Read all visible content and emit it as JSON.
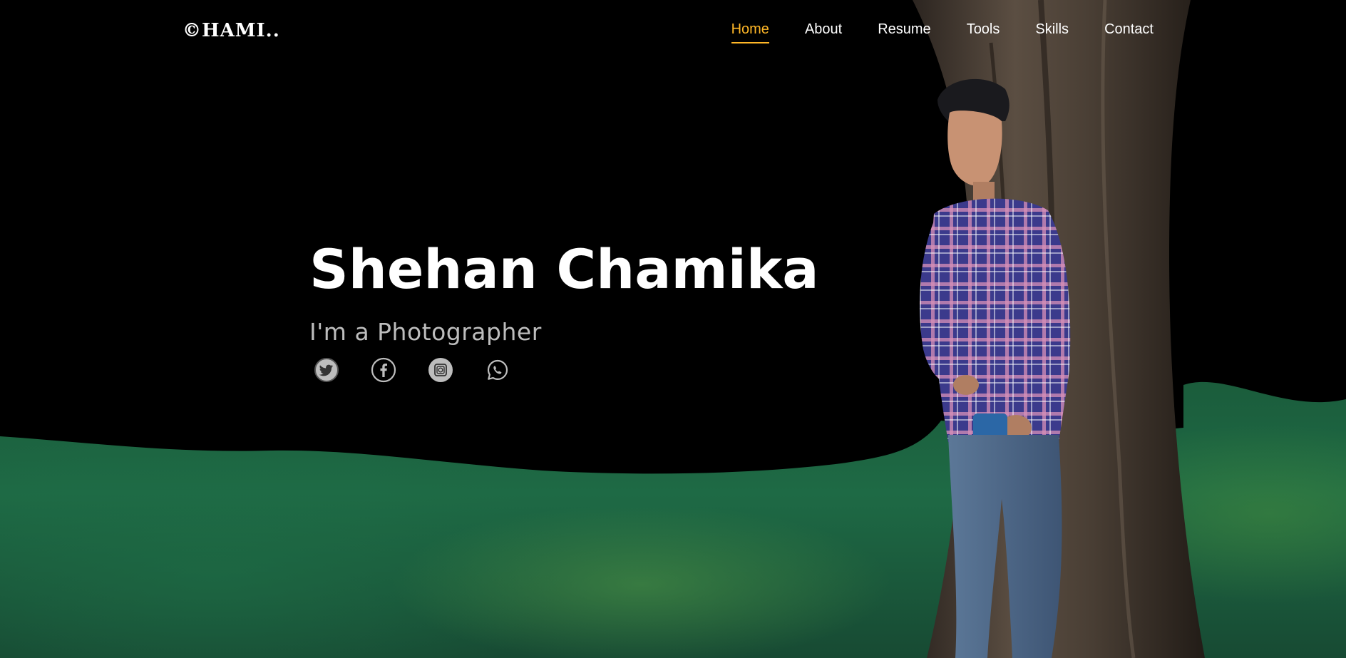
{
  "brand": {
    "logo_text": "©HAMI.."
  },
  "nav": {
    "items": [
      {
        "label": "Home",
        "active": true
      },
      {
        "label": "About",
        "active": false
      },
      {
        "label": "Resume",
        "active": false
      },
      {
        "label": "Tools",
        "active": false
      },
      {
        "label": "Skills",
        "active": false
      },
      {
        "label": "Contact",
        "active": false
      }
    ]
  },
  "hero": {
    "name": "Shehan Chamika",
    "subtitle": "I'm a Photographer"
  },
  "socials": [
    {
      "name": "twitter-icon"
    },
    {
      "name": "facebook-icon"
    },
    {
      "name": "instagram-icon"
    },
    {
      "name": "whatsapp-icon"
    }
  ],
  "colors": {
    "accent": "#ffb727",
    "text": "#ffffff",
    "subtitle": "#bdbdbd",
    "background": "#000000"
  }
}
